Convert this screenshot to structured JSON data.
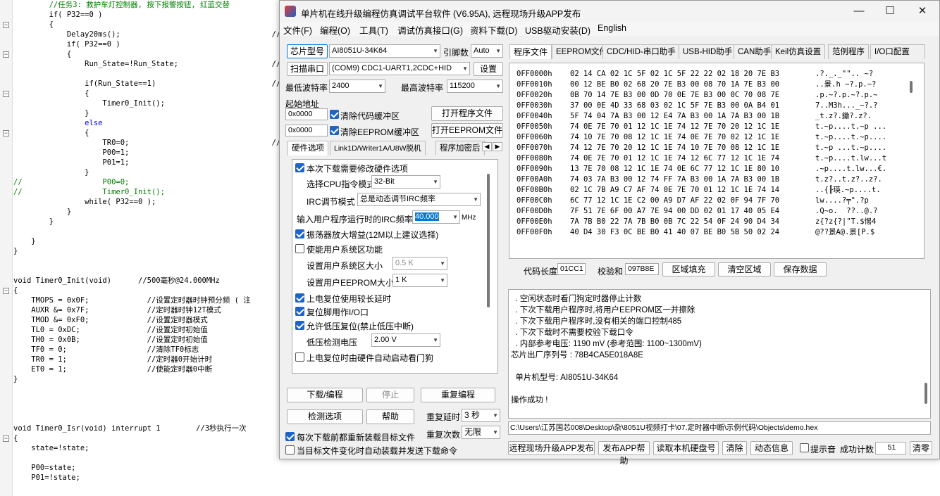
{
  "code_lines": [
    {
      "t": "        //任务3: 救护车灯控制器, 按下报警按钮, 红蓝交替",
      "c": "cm"
    },
    {
      "t": "        if( P32==0 )",
      "c": ""
    },
    {
      "t": "        {",
      "c": ""
    },
    {
      "t": "            Delay20ms();                                  //",
      "c": ""
    },
    {
      "t": "            if( P32==0 )",
      "c": ""
    },
    {
      "t": "            {",
      "c": ""
    },
    {
      "t": "                Run_State=!Run_State;                     //",
      "c": ""
    },
    {
      "t": "",
      "c": ""
    },
    {
      "t": "                if(Run_State==1)                          //",
      "c": ""
    },
    {
      "t": "                {",
      "c": ""
    },
    {
      "t": "                    Timer0_Init();",
      "c": ""
    },
    {
      "t": "                }",
      "c": ""
    },
    {
      "t": "                else",
      "c": "kw"
    },
    {
      "t": "                {",
      "c": ""
    },
    {
      "t": "                    TR0=0;                                //",
      "c": ""
    },
    {
      "t": "                    P00=1;",
      "c": ""
    },
    {
      "t": "                    P01=1;",
      "c": ""
    },
    {
      "t": "                }",
      "c": ""
    },
    {
      "t": "//                  P00=0;",
      "c": "cm"
    },
    {
      "t": "//                  Timer0_Init();",
      "c": "cm"
    },
    {
      "t": "                while( P32==0 );",
      "c": ""
    },
    {
      "t": "            }",
      "c": ""
    },
    {
      "t": "        }",
      "c": ""
    },
    {
      "t": "",
      "c": ""
    },
    {
      "t": "    }",
      "c": ""
    },
    {
      "t": "}",
      "c": ""
    },
    {
      "t": "",
      "c": ""
    },
    {
      "t": "",
      "c": ""
    },
    {
      "t": "void Timer0_Init(void)      //500毫秒@24.000MHz",
      "c": ""
    },
    {
      "t": "{",
      "c": ""
    },
    {
      "t": "    TMOPS = 0x0F;             //设置定时器时钟预分频 ( 注",
      "c": ""
    },
    {
      "t": "    AUXR &= 0x7F;             //定时器时钟12T模式",
      "c": ""
    },
    {
      "t": "    TMOD &= 0xF0;             //设置定时器模式",
      "c": ""
    },
    {
      "t": "    TL0 = 0xDC;               //设置定时初始值",
      "c": ""
    },
    {
      "t": "    TH0 = 0x0B;               //设置定时初始值",
      "c": ""
    },
    {
      "t": "    TF0 = 0;                  //清除TF0标志",
      "c": ""
    },
    {
      "t": "    TR0 = 1;                  //定时器0开始计时",
      "c": ""
    },
    {
      "t": "    ET0 = 1;                  //使能定时器0中断",
      "c": ""
    },
    {
      "t": "}",
      "c": ""
    },
    {
      "t": "",
      "c": ""
    },
    {
      "t": "",
      "c": ""
    },
    {
      "t": "",
      "c": ""
    },
    {
      "t": "",
      "c": ""
    },
    {
      "t": "void Timer0_Isr(void) interrupt 1        //3秒执行一次",
      "c": ""
    },
    {
      "t": "{",
      "c": ""
    },
    {
      "t": "    state=!state;",
      "c": ""
    },
    {
      "t": "",
      "c": ""
    },
    {
      "t": "    P00=state;",
      "c": ""
    },
    {
      "t": "    P01=!state;",
      "c": ""
    }
  ],
  "window": {
    "title": "单片机在线升级编程仿真调试平台软件 (V6.95A), 远程现场升级APP发布",
    "minimize": "—",
    "maximize": "☐",
    "close": "✕"
  },
  "menu": [
    "文件(F)",
    "编程(O)",
    "工具(T)",
    "调试仿真接口(G)",
    "资料下载(D)",
    "USB驱动安装(D)",
    "English"
  ],
  "left": {
    "chip_btn": "芯片型号",
    "chip_value": "AI8051U-34K64",
    "pin_label": "引脚数",
    "pin_value": "Auto",
    "port_btn": "扫描串口",
    "port_value": "(COM9) CDC1-UART1,2CDC+HID",
    "settings_btn": "设置",
    "min_baud_label": "最低波特率",
    "min_baud_value": "2400",
    "max_baud_label": "最高波特率",
    "max_baud_value": "115200",
    "start_addr_label": "起始地址",
    "addr1": "0x0000",
    "clear_code": "清除代码缓冲区",
    "open_prog": "打开程序文件",
    "addr2": "0x0000",
    "clear_eeprom": "清除EEPROM缓冲区",
    "open_eeprom": "打开EEPROM文件",
    "tabs": [
      "硬件选项",
      "Link1D/Writer1A/U8W脱机",
      "程序加密后"
    ],
    "hw": {
      "modify": "本次下载需要修改硬件选项",
      "cpu_mode_label": "选择CPU指令模式",
      "cpu_mode_value": "32-Bit",
      "irc_label": "IRC调节模式",
      "irc_value": "总是动态调节IRC频率",
      "freq_label": "输入用户程序运行时的IRC频率",
      "freq_value": "40.000",
      "freq_unit": "MHz",
      "osc_gain": "振荡器放大增益(12M以上建议选择)",
      "user_sys": "使能用户系统区功能",
      "user_sys_size_label": "设置用户系统区大小",
      "user_sys_size_value": "0.5 K",
      "eeprom_size_label": "设置用户EEPROM大小",
      "eeprom_size_value": "1   K",
      "long_delay": "上电复位使用较长延时",
      "reset_io": "复位脚用作I/O口",
      "low_volt_reset": "允许低压复位(禁止低压中断)",
      "low_volt_label": "低压检测电压",
      "low_volt_value": "2.00 V",
      "wdt": "上电复位时由硬件自动启动看门狗"
    },
    "download_btn": "下载/编程",
    "stop_btn": "停止",
    "reprog_btn": "重复编程",
    "detect_btn": "检测选项",
    "help_btn": "帮助",
    "repeat_delay_label": "重复延时",
    "repeat_delay_value": "3 秒",
    "repeat_count_label": "重复次数",
    "repeat_count_value": "无限",
    "reload_each": "每次下载前都重新装载目标文件",
    "auto_reload": "当目标文件变化时自动装载并发送下载命令"
  },
  "right": {
    "tabs": [
      "程序文件",
      "EEPROM文件",
      "CDC/HID-串口助手",
      "USB-HID助手",
      "CAN助手",
      "Keil仿真设置",
      "范例程序",
      "I/O口配置"
    ],
    "hex_rows": [
      {
        "a": "0FF0000h",
        "h": "02 14 CA 02 1C 5F 02 1C 5F 22 22 02 18 20 7E B3",
        "s": ".?._._\"\".. ~?"
      },
      {
        "a": "0FF0010h",
        "h": "00 12 BE B0 02 68 20 7E B3 00 08 70 1A 7E B3 00",
        "s": "..景.h ~?.p.~?"
      },
      {
        "a": "0FF0020h",
        "h": "0B 70 14 7E B3 00 0D 70 0E 7E B3 00 0C 70 08 7E",
        "s": ".p.~?.p.~?.p.~"
      },
      {
        "a": "0FF0030h",
        "h": "37 00 0E 4D 33 68 03 02 1C 5F 7E B3 00 0A B4 01",
        "s": "7..M3h..._~?.?"
      },
      {
        "a": "0FF0040h",
        "h": "5F 74 04 7A B3 00 12 E4 7A B3 00 1A 7A B3 00 1B",
        "s": "_t.z?.鋤?.z?."
      },
      {
        "a": "0FF0050h",
        "h": "74 0E 7E 70 01 12 1C 1E 74 12 7E 70 20 12 1C 1E",
        "s": "t.~p....t.~p ..."
      },
      {
        "a": "0FF0060h",
        "h": "74 10 7E 70 08 12 1C 1E 74 0E 7E 70 02 12 1C 1E",
        "s": "t.~p....t.~p...."
      },
      {
        "a": "0FF0070h",
        "h": "74 12 7E 70 20 12 1C 1E 74 10 7E 70 08 12 1C 1E",
        "s": "t.~p ...t.~p...."
      },
      {
        "a": "0FF0080h",
        "h": "74 0E 7E 70 01 12 1C 1E 74 12 6C 77 12 1C 1E 74",
        "s": "t.~p....t.lw...t"
      },
      {
        "a": "0FF0090h",
        "h": "13 7E 70 08 12 1C 1E 74 0E 6C 77 12 1C 1E 80 10",
        "s": ".~p....t.lw...€."
      },
      {
        "a": "0FF00A0h",
        "h": "74 03 7A B3 00 12 74 FF 7A B3 00 1A 7A B3 00 1B",
        "s": "t.z?..t.z?..z?."
      },
      {
        "a": "0FF00B0h",
        "h": "02 1C 7B A9 C7 AF 74 0E 7E 70 01 12 1C 1E 74 14",
        "s": "..{╟瑛.~p....t."
      },
      {
        "a": "0FF00C0h",
        "h": "6C 77 12 1C 1E C2 00 A9 D7 AF 22 02 0F 94 7F 70",
        "s": "lw....?╤\".?p"
      },
      {
        "a": "0FF00D0h",
        "h": "7F 51 7E 6F 00 A7 7E 94 00 DD 02 01 17 40 05 E4",
        "s": ".Q~o.  ??..@.?"
      },
      {
        "a": "0FF00E0h",
        "h": "7A 7B B0 22 7A 7B B0 0B 7C 22 54 0F 24 90 D4 34",
        "s": "z{?z{?|\"T.$惕4"
      },
      {
        "a": "0FF00F0h",
        "h": "40 D4 30 F3 0C BE B0 41 40 07 BE B0 5B 50 02 24",
        "s": "@??景A@.景[P.$"
      }
    ],
    "code_len_label": "代码长度",
    "code_len_value": "01CC1",
    "checksum_label": "校验和",
    "checksum_value": "097B8E",
    "fill_btn": "区域填充",
    "clear_btn": "清空区域",
    "save_btn": "保存数据",
    "log_lines": [
      "  . 空闲状态时看门狗定时器停止计数",
      "  . 下次下载用户程序时,将用户EEPROM区一并擦除",
      "  . 下次下载用户程序时,没有相关的端口控制485",
      "  . 下次下载时不需要校验下载口令",
      "  . 内部参考电压: 1190 mV (参考范围: 1100~1300mV)",
      "芯片出厂序列号 : 78B4CA5E018A8E",
      "",
      "  单片机型号: AI8051U-34K64",
      "",
      "操作成功 !"
    ],
    "path": "C:\\Users\\江苏国芯008\\Desktop\\杂\\8051U视频打卡\\07.定时器中断\\示例代码\\Objects\\demo.hex",
    "bottom": {
      "publish_btn": "远程现场升级APP发布",
      "help_btn": "发布APP帮助",
      "read_disk_btn": "读取本机硬盘号",
      "clear_btn": "清除",
      "anim_btn": "动态信息",
      "beep_label": "提示音",
      "success_label": "成功计数",
      "success_value": "51",
      "reset_btn": "清零"
    }
  }
}
